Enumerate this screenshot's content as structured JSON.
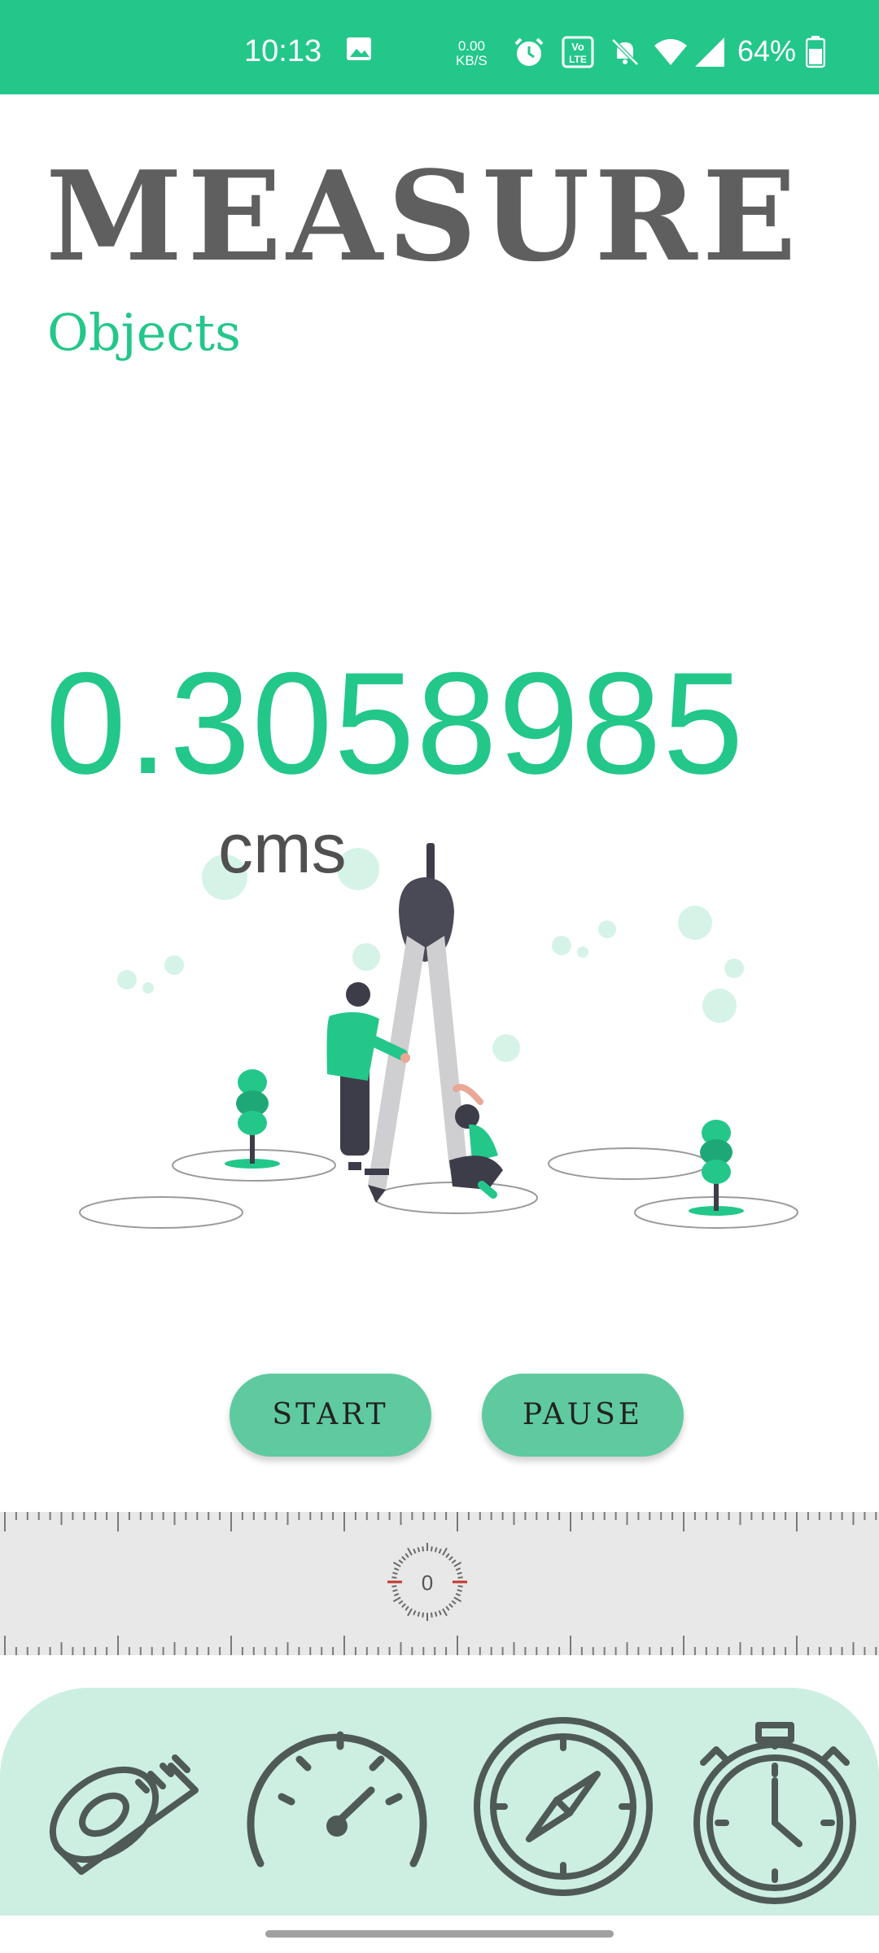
{
  "status_bar": {
    "time": "10:13",
    "net_speed_value": "0.00",
    "net_speed_unit": "KB/S",
    "volte": "Vo LTE",
    "battery": "64%",
    "icons": [
      "image-icon",
      "alarm-icon",
      "volte-icon",
      "mute-icon",
      "wifi-icon",
      "signal-icon",
      "battery-icon"
    ]
  },
  "header": {
    "title": "MEASURE",
    "subtitle": "Objects"
  },
  "reading": {
    "value": "0.3058985",
    "unit": "cms"
  },
  "controls": {
    "start_label": "START",
    "pause_label": "PAUSE"
  },
  "ruler": {
    "center_value": "0"
  },
  "dock": {
    "items": [
      {
        "icon": "tape-measure-icon"
      },
      {
        "icon": "speedometer-icon"
      },
      {
        "icon": "compass-icon"
      },
      {
        "icon": "stopwatch-icon"
      }
    ]
  },
  "colors": {
    "accent": "#23c78a",
    "button": "#5fcaa0",
    "dock": "#ccefe2",
    "title": "#5f5f5f",
    "icon": "#4f5a57"
  }
}
